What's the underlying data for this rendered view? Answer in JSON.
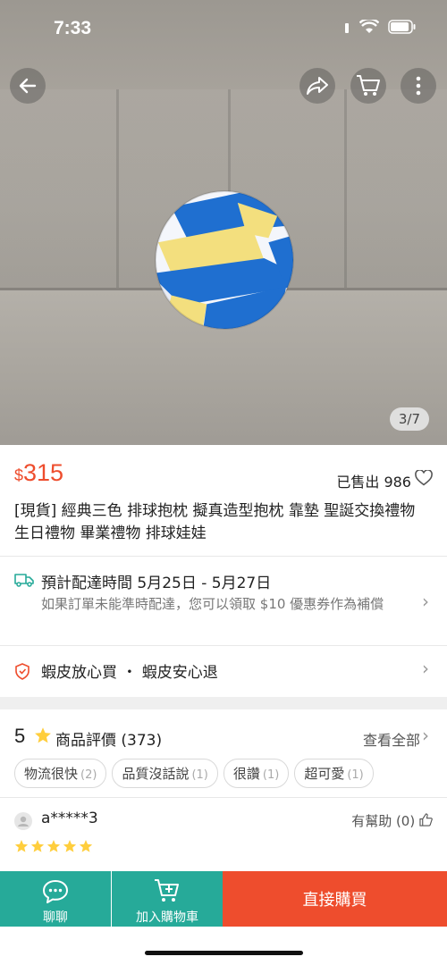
{
  "status_bar": {
    "time": "7:33"
  },
  "hero": {
    "counter": "3/7"
  },
  "product": {
    "currency": "$",
    "price": "315",
    "sold": "已售出 986",
    "title": "[現貨] 經典三色 排球抱枕 擬真造型抱枕 靠墊 聖誕交換禮物 生日禮物 畢業禮物 排球娃娃"
  },
  "shipping": {
    "title": "預計配達時間 5月25日 - 5月27日",
    "subtitle": "如果訂單未能準時配達，您可以領取 $10 優惠券作為補償"
  },
  "guarantee": {
    "text": "蝦皮放心買 ・ 蝦皮安心退"
  },
  "reviews": {
    "score": "5",
    "label": "商品評價 (373)",
    "see_all": "查看全部",
    "tags": [
      {
        "label": "物流很快",
        "count": "(2)"
      },
      {
        "label": "品質沒話說",
        "count": "(1)"
      },
      {
        "label": "很讚",
        "count": "(1)"
      },
      {
        "label": "超可愛",
        "count": "(1)"
      }
    ],
    "first_review": {
      "user": "a*****3",
      "helpful": "有幫助 (0)",
      "stars": 5
    }
  },
  "bottom_bar": {
    "chat_label": "聊聊",
    "cart_label": "加入購物車",
    "buy_label": "直接購買"
  },
  "colors": {
    "brand": "#ee4d2d",
    "teal": "#26aa99",
    "star": "#ffce3d"
  }
}
